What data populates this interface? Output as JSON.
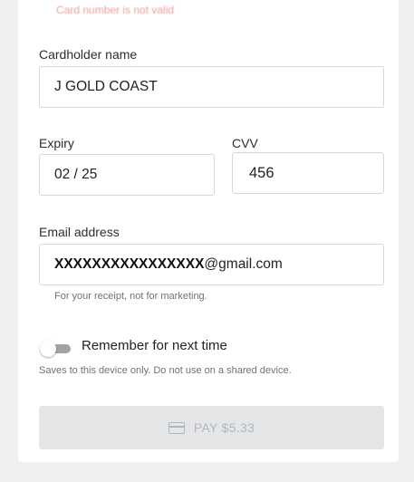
{
  "form": {
    "top_error": "Card number is not valid",
    "cardholder": {
      "label": "Cardholder name",
      "value": "J GOLD COAST"
    },
    "expiry": {
      "label": "Expiry",
      "value": "02 / 25"
    },
    "cvv": {
      "label": "CVV",
      "value": "456"
    },
    "email": {
      "label": "Email address",
      "masked_part": "XXXXXXXXXXXXXXXX",
      "domain_part": "@gmail.com",
      "helper": "For your receipt, not for marketing."
    },
    "remember": {
      "label": "Remember for next time",
      "helper": "Saves to this device only. Do not use on a shared device.",
      "enabled": false
    },
    "pay_button": {
      "label": "PAY $5.33",
      "icon": "credit-card-icon",
      "disabled": true
    }
  },
  "colors": {
    "background": "#eef0f1",
    "card": "#ffffff",
    "error": "#e04a4a",
    "button_disabled": "#e4e6e7"
  }
}
